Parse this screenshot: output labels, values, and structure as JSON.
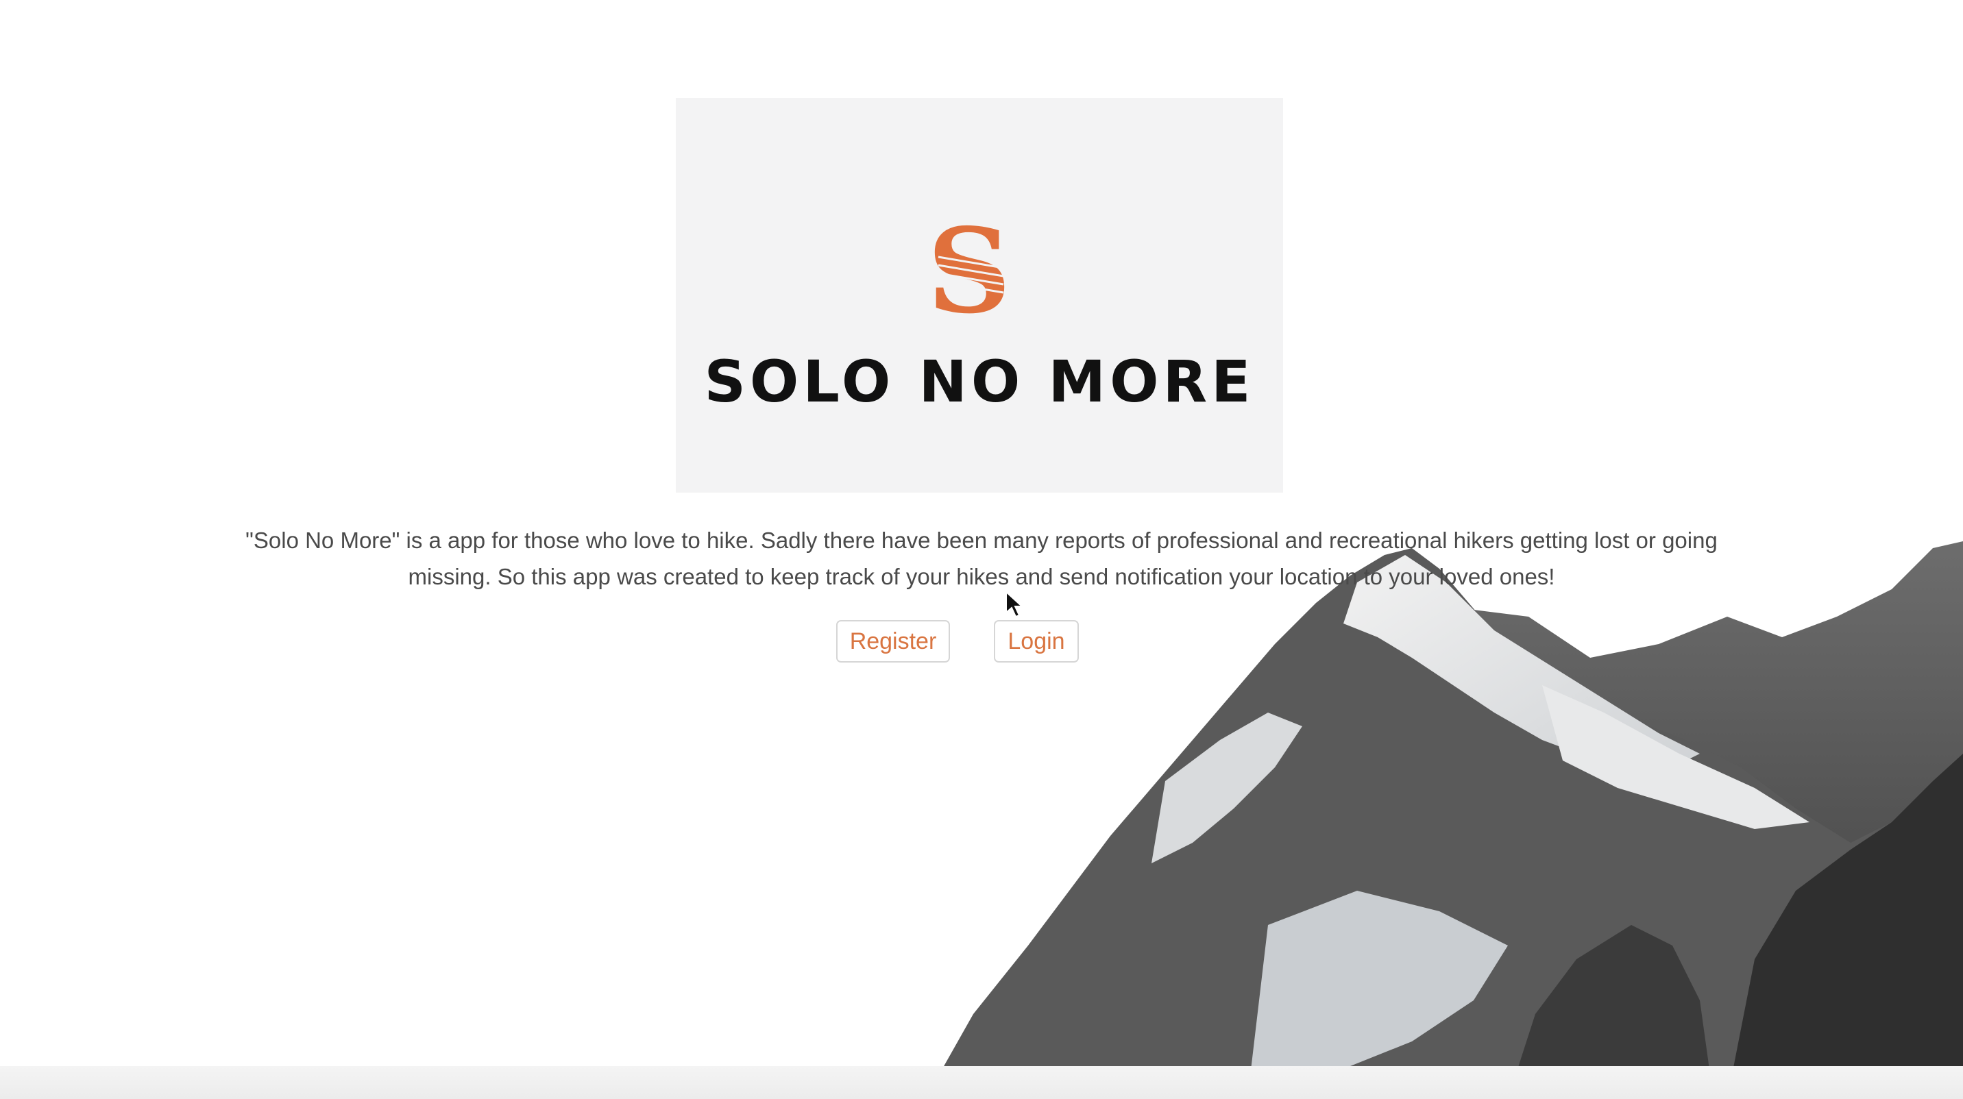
{
  "logo": {
    "title": "SOLO NO MORE",
    "mark_icon": "s-monogram-icon",
    "mark_color": "#e0703c"
  },
  "intro": {
    "description": "\"Solo No More\" is a app for those who love to hike. Sadly there have been many reports of professional and recreational hikers getting lost or going missing. So this app was created to keep track of your hikes and send notification your location to your loved ones!"
  },
  "actions": {
    "register_label": "Register",
    "login_label": "Login"
  },
  "colors": {
    "accent": "#d97541",
    "text": "#4a4a4a",
    "card": "#f3f3f4"
  },
  "background": {
    "image_icon": "snowy-mountains-image"
  }
}
